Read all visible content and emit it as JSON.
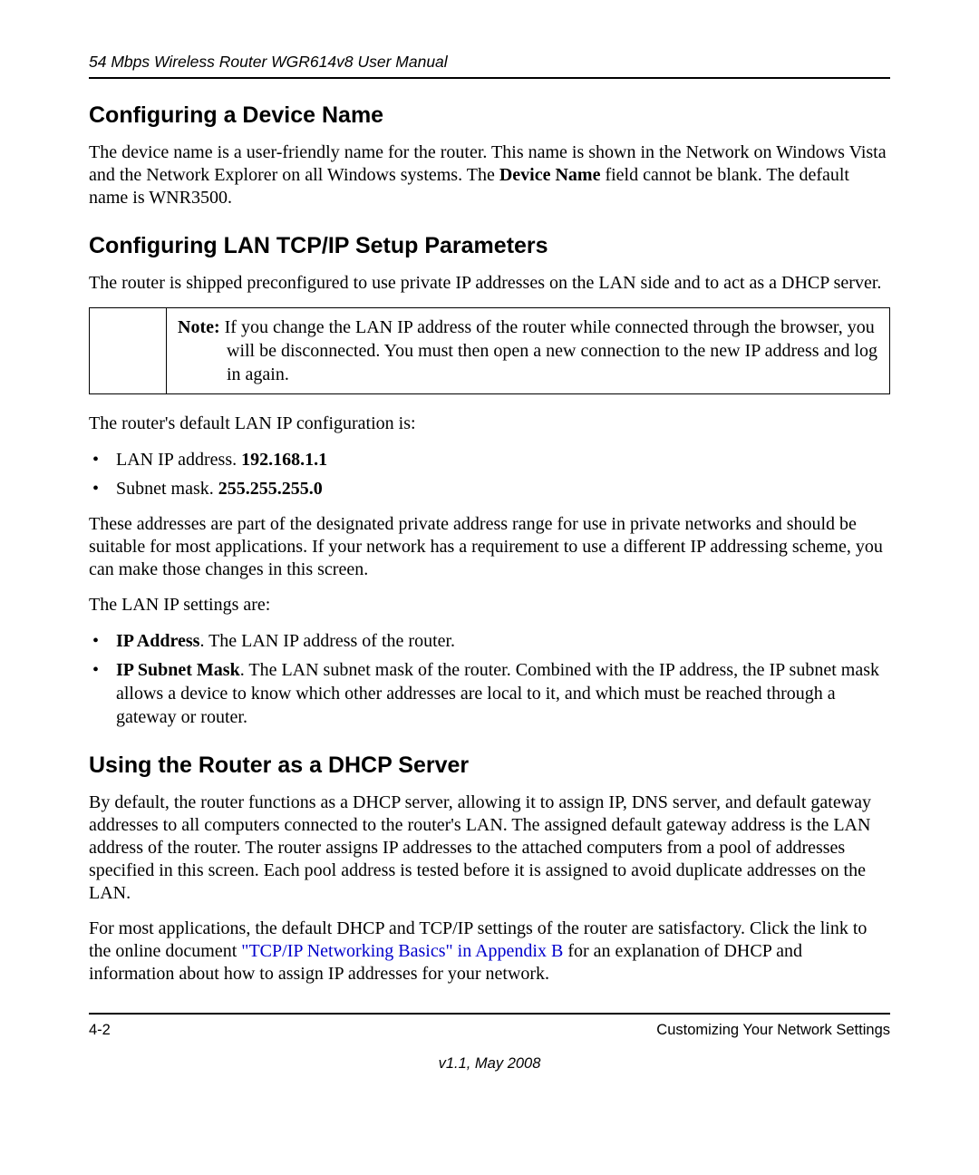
{
  "runningHead": "54 Mbps Wireless Router WGR614v8 User Manual",
  "sections": {
    "s1": {
      "title": "Configuring a Device Name",
      "p1a": "The device name is a user-friendly name for the router. This name is shown in the Network on Windows Vista and the Network Explorer on all Windows systems. The ",
      "p1b": "Device Name",
      "p1c": " field cannot be blank. The default name is WNR3500."
    },
    "s2": {
      "title": "Configuring LAN TCP/IP Setup Parameters",
      "p1": "The router is shipped preconfigured to use private IP addresses on the LAN side and to act as a DHCP server.",
      "noteLabel": "Note:",
      "noteText": " If you change the LAN IP address of the router while connected through the browser, you will be disconnected. You must then open a new connection to the new IP address and log in again.",
      "p2": "The router's default LAN IP configuration is:",
      "b1a": "LAN IP address. ",
      "b1b": "192.168.1.1",
      "b2a": "Subnet mask. ",
      "b2b": "255.255.255.0",
      "p3": "These addresses are part of the designated private address range for use in private networks and should be suitable for most applications. If your network has a requirement to use a different IP addressing scheme, you can make those changes in this screen.",
      "p4": "The LAN IP settings are:",
      "b3a": "IP Address",
      "b3b": ". The LAN IP address of the router.",
      "b4a": "IP Subnet Mask",
      "b4b": ". The LAN subnet mask of the router. Combined with the IP address, the IP subnet mask allows a device to know which other addresses are local to it, and which must be reached through a gateway or router."
    },
    "s3": {
      "title": "Using the Router as a DHCP Server",
      "p1": "By default, the router functions as a DHCP server, allowing it to assign IP, DNS server, and default gateway addresses to all computers connected to the router's LAN. The assigned default gateway address is the LAN address of the router. The router assigns IP addresses to the attached computers from a pool of addresses specified in this screen. Each pool address is tested before it is assigned to avoid duplicate addresses on the LAN.",
      "p2a": "For most applications, the default DHCP and TCP/IP settings of the router are satisfactory. Click the link to the online document ",
      "p2link": "\"TCP/IP Networking Basics\" in Appendix B",
      "p2b": " for an explanation of DHCP and information about how to assign IP addresses for your network."
    }
  },
  "footer": {
    "pageNum": "4-2",
    "sectionTitle": "Customizing Your Network Settings",
    "version": "v1.1, May 2008"
  }
}
